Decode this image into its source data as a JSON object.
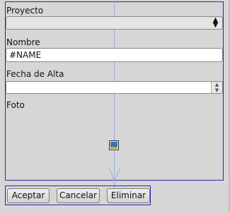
{
  "form": {
    "proyecto_label": "Proyecto",
    "proyecto_value": "",
    "nombre_label": "Nombre",
    "nombre_value": "#NAME",
    "fecha_label": "Fecha de Alta",
    "fecha_value": "",
    "foto_label": "Foto"
  },
  "buttons": {
    "aceptar": "Aceptar",
    "cancelar": "Cancelar",
    "eliminar": "Eliminar"
  },
  "icons": {
    "combo_spin": "up-down-arrows-icon",
    "date_spin": "spinner-icon",
    "photo": "image-placeholder-icon",
    "guide_arrow": "down-arrow-guide-icon"
  },
  "colors": {
    "background": "#d6d6d6",
    "frame_border": "#2a2aa8",
    "guide_line": "#9aa8e6"
  }
}
